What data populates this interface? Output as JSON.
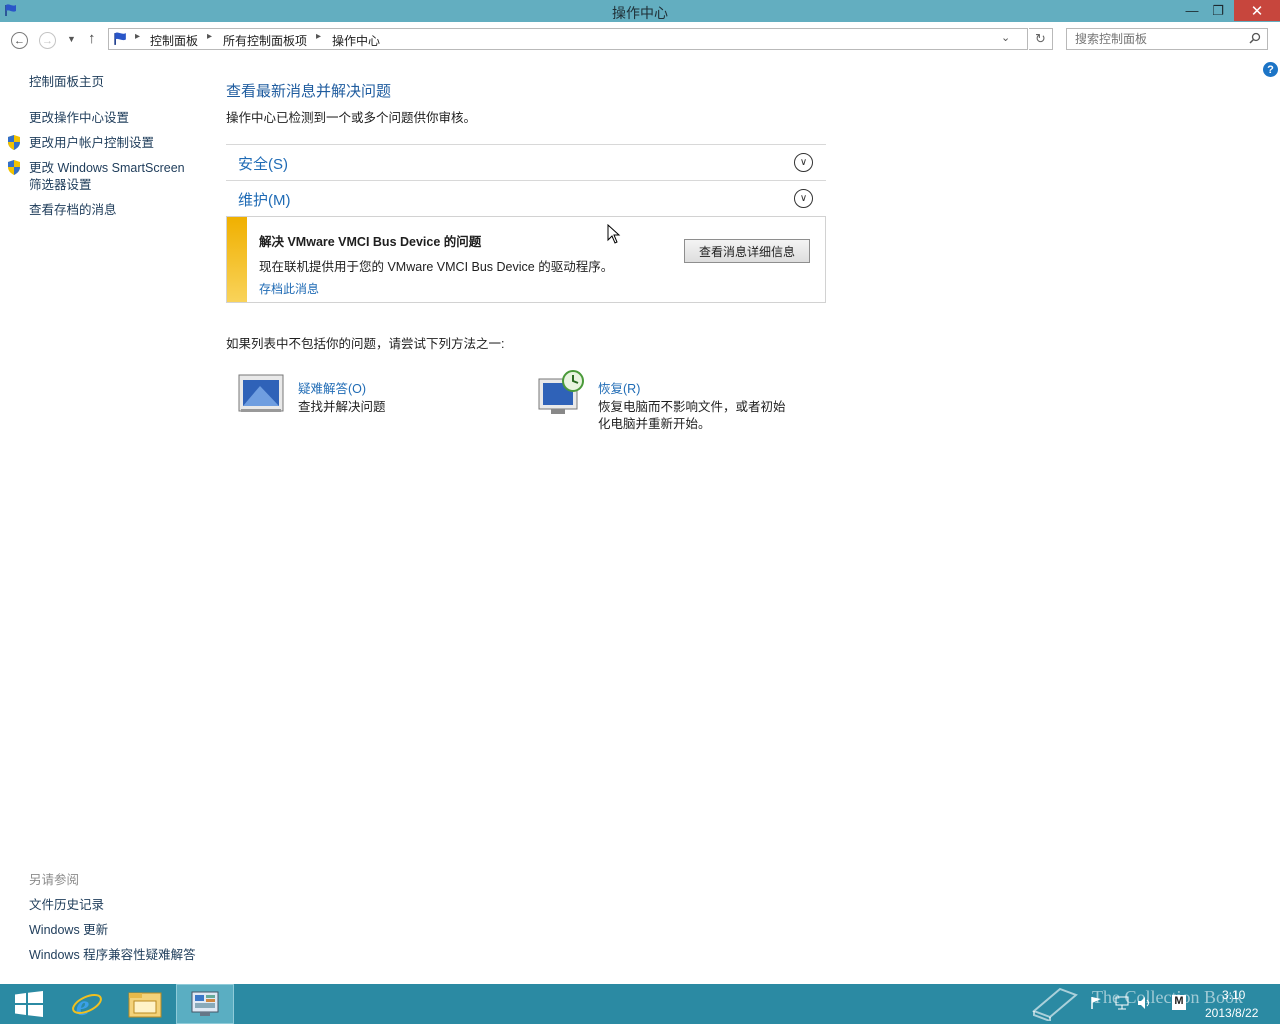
{
  "window": {
    "title": "操作中心",
    "minimize": "—",
    "restore": "❐",
    "close": "✕"
  },
  "address_bar": {
    "breadcrumbs": [
      "控制面板",
      "所有控制面板项",
      "操作中心"
    ],
    "search_placeholder": "搜索控制面板"
  },
  "sidebar": {
    "home": "控制面板主页",
    "items": [
      "更改操作中心设置",
      "更改用户帐户控制设置",
      "更改 Windows SmartScreen",
      "筛选器设置",
      "查看存档的消息"
    ],
    "see_also_heading": "另请参阅",
    "see_also": [
      "文件历史记录",
      "Windows 更新",
      "Windows 程序兼容性疑难解答"
    ]
  },
  "main": {
    "title": "查看最新消息并解决问题",
    "subtitle": "操作中心已检测到一个或多个问题供你审核。",
    "sections": [
      {
        "label": "安全(S)"
      },
      {
        "label": "维护(M)"
      }
    ],
    "message": {
      "title": "解决 VMware VMCI Bus Device 的问题",
      "text": "现在联机提供用于您的 VMware VMCI Bus Device 的驱动程序。",
      "archive_link": "存档此消息",
      "details_button": "查看消息详细信息"
    },
    "alternative_text": "如果列表中不包括你的问题，请尝试下列方法之一:",
    "tools": [
      {
        "title": "疑难解答(O)",
        "desc": [
          "查找并解决问题"
        ]
      },
      {
        "title": "恢复(R)",
        "desc": [
          "恢复电脑而不影响文件，或者初始",
          "化电脑并重新开始。"
        ]
      }
    ]
  },
  "taskbar": {
    "time": "3:10",
    "date": "2013/8/22",
    "watermark": "The Collection Book",
    "tray_letter": "M"
  },
  "colors": {
    "titlebar": "#63aec0",
    "taskbar": "#2b8aa3",
    "link": "#1f6bb5",
    "warning": "#f0b000"
  }
}
